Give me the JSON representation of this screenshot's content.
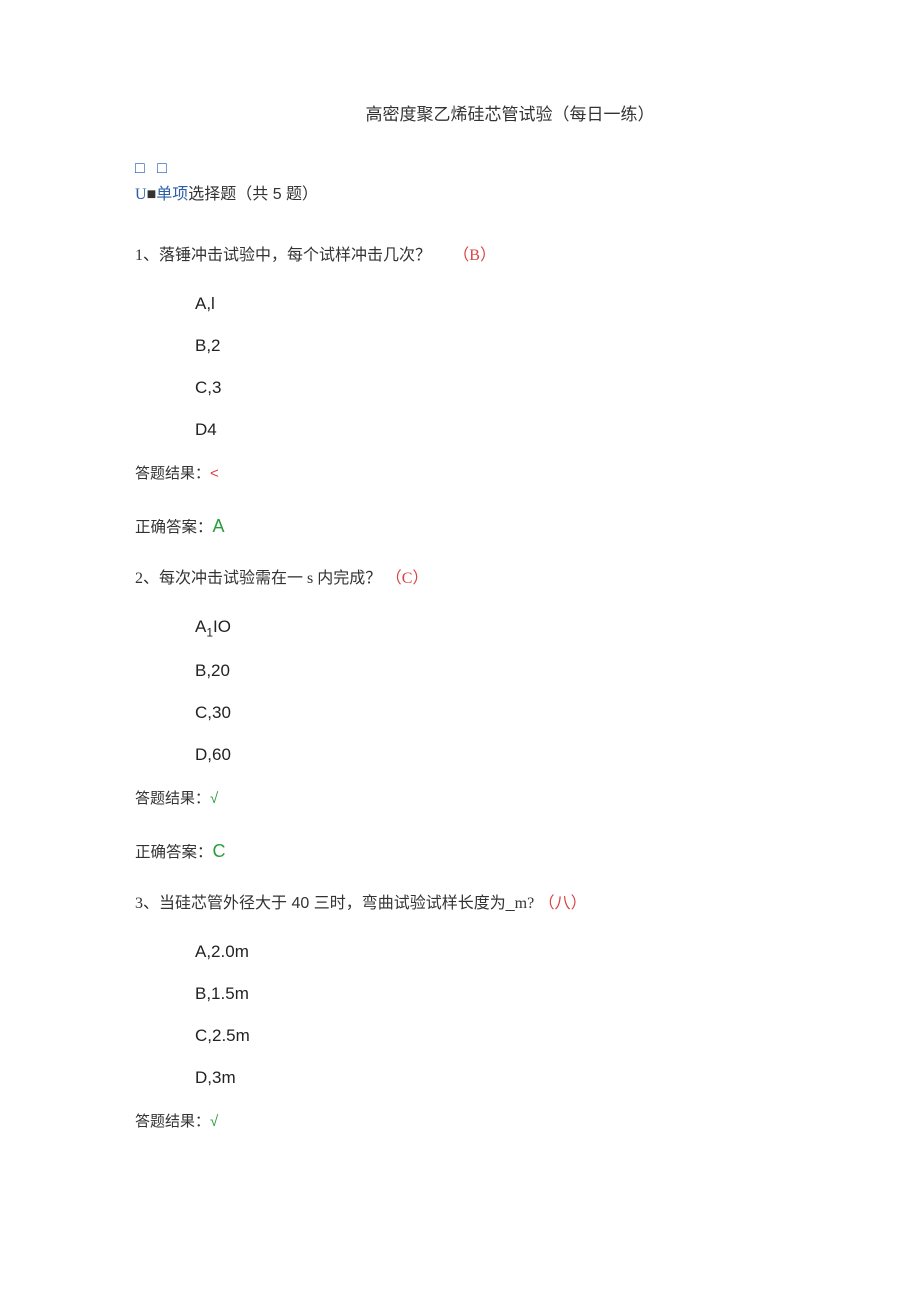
{
  "title": "高密度聚乙烯硅芯管试验（每日一练）",
  "boxesPlaceholder": "□ □",
  "sectionHeader": {
    "prefix": "U",
    "dot": "■",
    "text1": "单项",
    "text2": "选择题（共 5 题）"
  },
  "resultLabel": "答题结果：",
  "correctLabel": "正确答案：",
  "questions": [
    {
      "num": "1、",
      "text": "落锤冲击试验中，每个试样冲击几次？",
      "mark": "（B）",
      "options": [
        "A,l",
        "B,2",
        "C,3",
        "D4"
      ],
      "resultMark": "<",
      "resultCorrect": false,
      "correct": "A"
    },
    {
      "num": "2、",
      "textPre": "每次冲击试验需在一",
      "textMid": " s ",
      "textPost": "内完成？",
      "mark": "（C）",
      "options": [
        "A₁IO",
        "B,20",
        "C,30",
        "D,60"
      ],
      "resultMark": "√",
      "resultCorrect": true,
      "correct": "C"
    },
    {
      "num": "3、",
      "textPre": "当硅芯管外径大于 40 三时，弯曲试验试样长度为",
      "textUnderscore": "_",
      "textPost": "m?",
      "mark": "（八）",
      "options": [
        "A,2.0m",
        "B,1.5m",
        "C,2.5m",
        "D,3m"
      ],
      "resultMark": "√",
      "resultCorrect": true
    }
  ]
}
